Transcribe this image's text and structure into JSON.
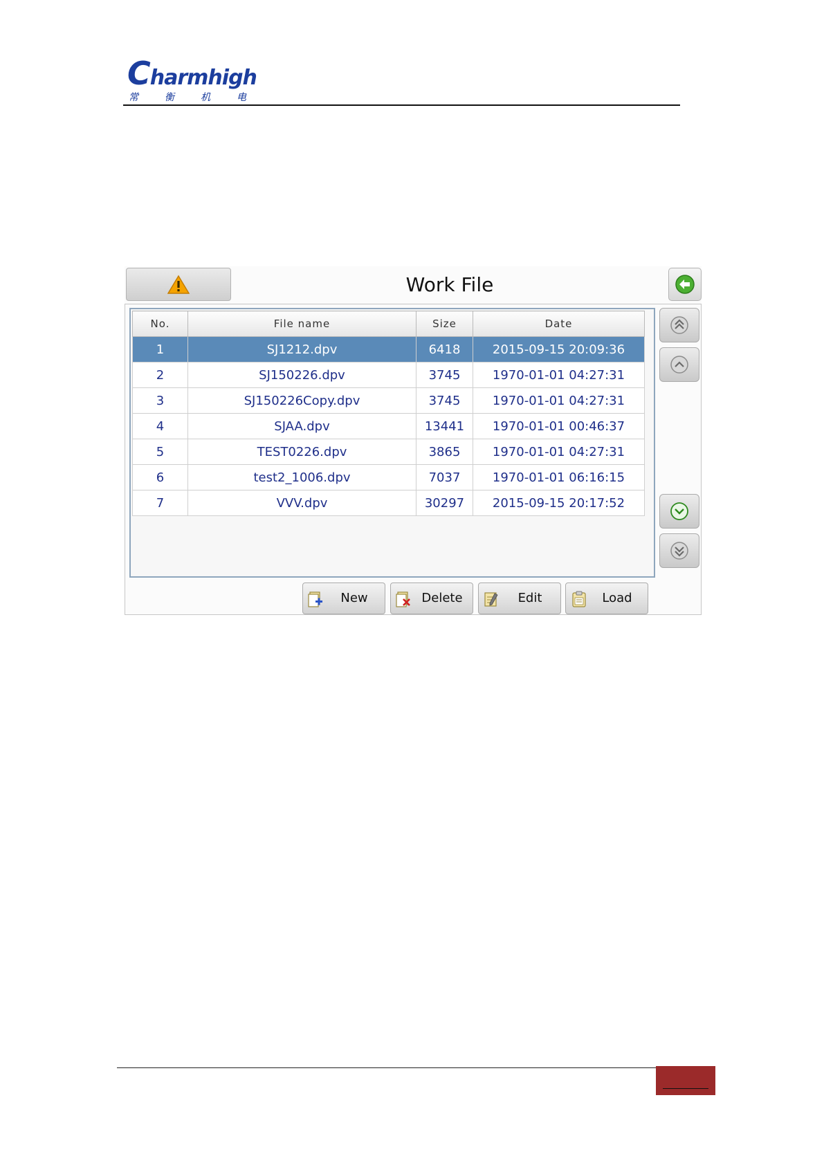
{
  "header": {
    "logo_text": "Charmhigh",
    "logo_chars": [
      "常",
      "衡",
      "机",
      "电"
    ]
  },
  "window": {
    "title": "Work File"
  },
  "table": {
    "columns": [
      "No.",
      "File name",
      "Size",
      "Date"
    ],
    "rows": [
      {
        "no": "1",
        "name": "SJ1212.dpv",
        "size": "6418",
        "date": "2015-09-15 20:09:36",
        "selected": true
      },
      {
        "no": "2",
        "name": "SJ150226.dpv",
        "size": "3745",
        "date": "1970-01-01 04:27:31"
      },
      {
        "no": "3",
        "name": "SJ150226Copy.dpv",
        "size": "3745",
        "date": "1970-01-01 04:27:31"
      },
      {
        "no": "4",
        "name": "SJAA.dpv",
        "size": "13441",
        "date": "1970-01-01 00:46:37"
      },
      {
        "no": "5",
        "name": "TEST0226.dpv",
        "size": "3865",
        "date": "1970-01-01 04:27:31"
      },
      {
        "no": "6",
        "name": "test2_1006.dpv",
        "size": "7037",
        "date": "1970-01-01 06:16:15"
      },
      {
        "no": "7",
        "name": "VVV.dpv",
        "size": "30297",
        "date": "2015-09-15 20:17:52"
      }
    ]
  },
  "actions": {
    "new_label": "New",
    "delete_label": "Delete",
    "edit_label": "Edit",
    "load_label": "Load"
  },
  "icons": {
    "warning": "warning-icon",
    "back": "back-arrow-icon",
    "page_first": "double-chevron-up-icon",
    "page_up": "chevron-up-icon",
    "page_down": "chevron-down-icon",
    "page_last": "double-chevron-down-icon",
    "new": "new-file-icon",
    "delete": "delete-file-icon",
    "edit": "edit-file-icon",
    "load": "load-clipboard-icon"
  },
  "colors": {
    "brand": "#1c3e9e",
    "selected_row": "#5a8ab8",
    "cell_text": "#1f2f8a",
    "footer_tab": "#9b2a2a"
  }
}
